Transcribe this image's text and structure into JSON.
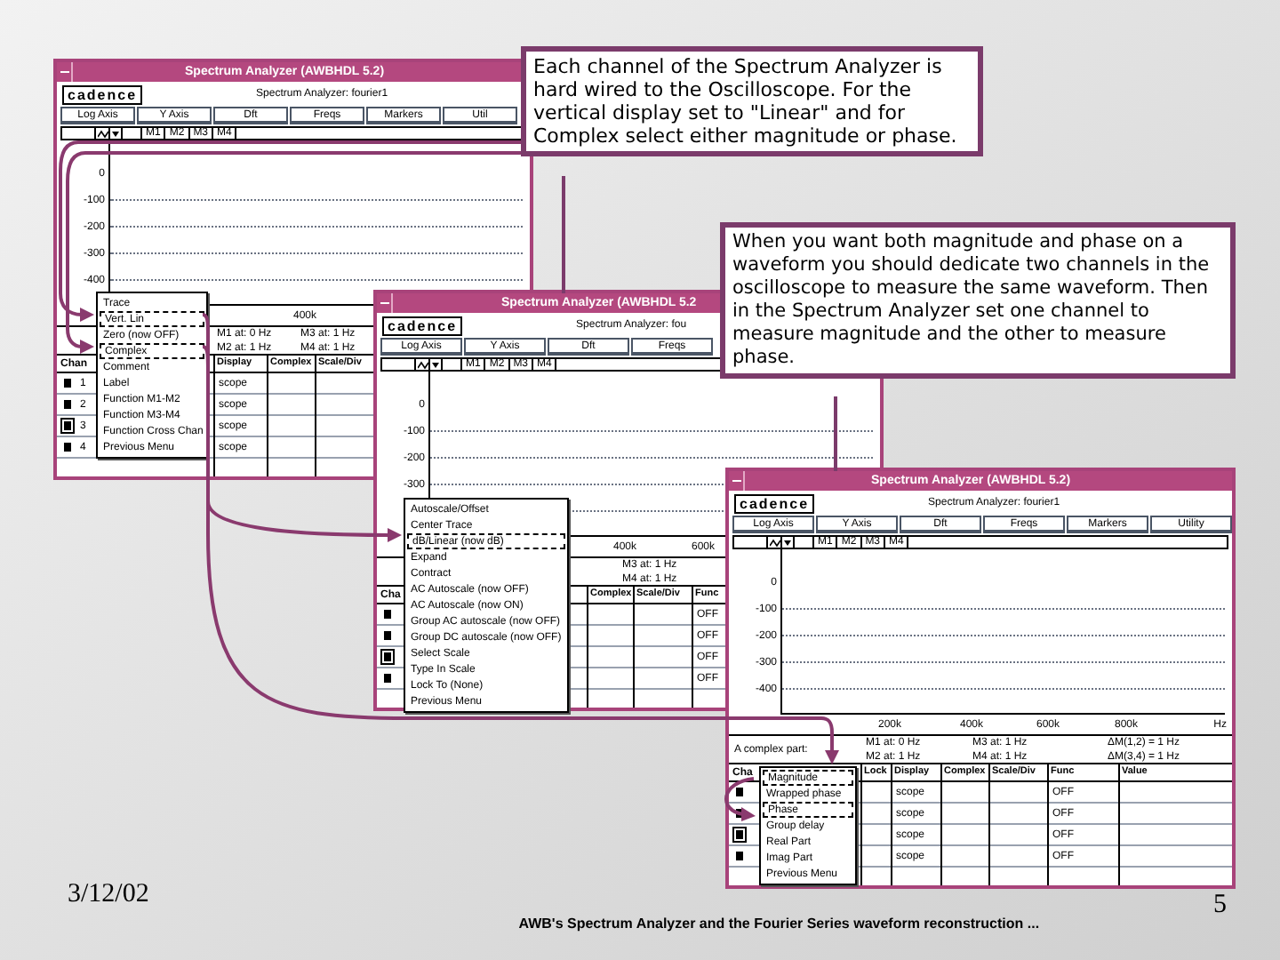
{
  "windows": [
    {
      "title": "Spectrum Analyzer (AWBHDL 5.2)",
      "logo": "cadence",
      "subtitle": "Spectrum Analyzer: fourier1",
      "toolbar": [
        "Log Axis",
        "Y Axis",
        "Dft",
        "Freqs",
        "Markers",
        "Util"
      ],
      "markers": [
        "M1",
        "M2",
        "M3",
        "M4"
      ],
      "y_ticks": [
        "0",
        "-100",
        "-200",
        "-300",
        "-400"
      ],
      "x_ticks": [
        "400k"
      ],
      "info": [
        {
          "lines": [
            "M1 at: 0 Hz",
            "M2 at: 1 Hz"
          ]
        },
        {
          "lines": [
            "M3 at: 1 Hz",
            "M4 at: 1 Hz"
          ]
        }
      ],
      "menu": [
        {
          "label": "Trace",
          "selected": false
        },
        {
          "label": "Vert. Lin",
          "selected": true
        },
        {
          "label": "Zero (now OFF)",
          "selected": false
        },
        {
          "label": "Complex",
          "selected": true
        },
        {
          "label": "Comment",
          "selected": false
        },
        {
          "label": "Label",
          "selected": false
        },
        {
          "label": "Function M1-M2",
          "selected": false
        },
        {
          "label": "Function M3-M4",
          "selected": false
        },
        {
          "label": "Function Cross Chan",
          "selected": false
        },
        {
          "label": "Previous Menu",
          "selected": false
        }
      ],
      "table": {
        "channel_header": "Chan",
        "channels": [
          {
            "number": "1",
            "selected": false
          },
          {
            "number": "2",
            "selected": false
          },
          {
            "number": "3",
            "selected": true
          },
          {
            "number": "4",
            "selected": false
          }
        ],
        "columns": [
          {
            "label": "Display",
            "cells": [
              "scope",
              "scope",
              "scope",
              "scope"
            ]
          },
          {
            "label": "Complex"
          },
          {
            "label": "Scale/Div"
          }
        ]
      }
    },
    {
      "title": "Spectrum Analyzer (AWBHDL 5.2",
      "logo": "cadence",
      "subtitle": "Spectrum Analyzer: fou",
      "toolbar": [
        "Log Axis",
        "Y Axis",
        "Dft",
        "Freqs"
      ],
      "markers": [
        "M1",
        "M2",
        "M3",
        "M4"
      ],
      "y_ticks": [
        "0",
        "-100",
        "-200",
        "-300"
      ],
      "x_ticks": [
        "400k",
        "600k"
      ],
      "info": [
        {
          "lines": [
            "M3 at: 1 Hz",
            "M4 at: 1 Hz"
          ]
        }
      ],
      "menu": [
        {
          "label": "Autoscale/Offset",
          "selected": false
        },
        {
          "label": "Center Trace",
          "selected": false
        },
        {
          "label": "dB/Linear (now dB)",
          "selected": true
        },
        {
          "label": "Expand",
          "selected": false
        },
        {
          "label": "Contract",
          "selected": false
        },
        {
          "label": "AC Autoscale (now OFF)",
          "selected": false
        },
        {
          "label": "AC Autoscale (now ON)",
          "selected": false
        },
        {
          "label": "Group AC autoscale (now OFF)",
          "selected": false
        },
        {
          "label": "Group DC autoscale (now OFF)",
          "selected": false
        },
        {
          "label": "Select Scale",
          "selected": false
        },
        {
          "label": "Type In Scale",
          "selected": false
        },
        {
          "label": "Lock To (None)",
          "selected": false
        },
        {
          "label": "Previous Menu",
          "selected": false
        }
      ],
      "table": {
        "channel_header": "Cha",
        "channels": [
          {
            "selected": false
          },
          {
            "selected": false
          },
          {
            "selected": true
          },
          {
            "selected": false
          }
        ],
        "columns": [
          {
            "label": "Complex"
          },
          {
            "label": "Scale/Div"
          },
          {
            "label": "Func",
            "cells": [
              "OFF",
              "OFF",
              "OFF",
              "OFF"
            ]
          }
        ]
      }
    },
    {
      "title": "Spectrum Analyzer (AWBHDL 5.2)",
      "logo": "cadence",
      "subtitle": "Spectrum Analyzer: fourier1",
      "toolbar": [
        "Log Axis",
        "Y Axis",
        "Dft",
        "Freqs",
        "Markers",
        "Utility"
      ],
      "markers": [
        "M1",
        "M2",
        "M3",
        "M4"
      ],
      "y_ticks": [
        "0",
        "-100",
        "-200",
        "-300",
        "-400"
      ],
      "x_ticks": [
        "200k",
        "400k",
        "600k",
        "800k"
      ],
      "x_unit": "Hz",
      "info": [
        {
          "lines": [
            "A complex part:"
          ]
        },
        {
          "lines": [
            "M1 at: 0 Hz",
            "M2 at: 1 Hz"
          ]
        },
        {
          "lines": [
            "M3 at: 1 Hz",
            "M4 at: 1 Hz"
          ]
        },
        {
          "lines": [
            "ΔM(1,2) = 1 Hz",
            "ΔM(3,4) = 1 Hz"
          ]
        }
      ],
      "menu": [
        {
          "label": "Magnitude",
          "selected": true
        },
        {
          "label": "Wrapped phase",
          "selected": false
        },
        {
          "label": "Phase",
          "selected": true
        },
        {
          "label": "Group delay",
          "selected": false
        },
        {
          "label": "Real Part",
          "selected": false
        },
        {
          "label": "Imag Part",
          "selected": false
        },
        {
          "label": "Previous Menu",
          "selected": false
        }
      ],
      "table": {
        "channel_header": "Cha",
        "channels": [
          {
            "selected": false
          },
          {
            "selected": false
          },
          {
            "selected": true
          },
          {
            "selected": false
          }
        ],
        "columns": [
          {
            "label": "Lock"
          },
          {
            "label": "Display",
            "cells": [
              "scope",
              "scope",
              "scope",
              "scope"
            ]
          },
          {
            "label": "Complex"
          },
          {
            "label": "Scale/Div"
          },
          {
            "label": "Func",
            "cells": [
              "OFF",
              "OFF",
              "OFF",
              "OFF"
            ]
          },
          {
            "label": "Value"
          }
        ]
      }
    }
  ],
  "callouts": [
    "Each channel of the Spectrum Analyzer is hard wired to the Oscilloscope.  For the vertical display set to \"Linear\" and for Complex select either magnitude or phase.",
    "When you want both magnitude and phase on a waveform you should dedicate two channels in the oscilloscope to measure the same waveform.  Then in the Spectrum Analyzer set one channel to measure magnitude and the other to measure phase."
  ],
  "footer": {
    "date": "3/12/02",
    "caption": "AWB's Spectrum Analyzer and the Fourier Series waveform reconstruction ...",
    "page": "5"
  }
}
